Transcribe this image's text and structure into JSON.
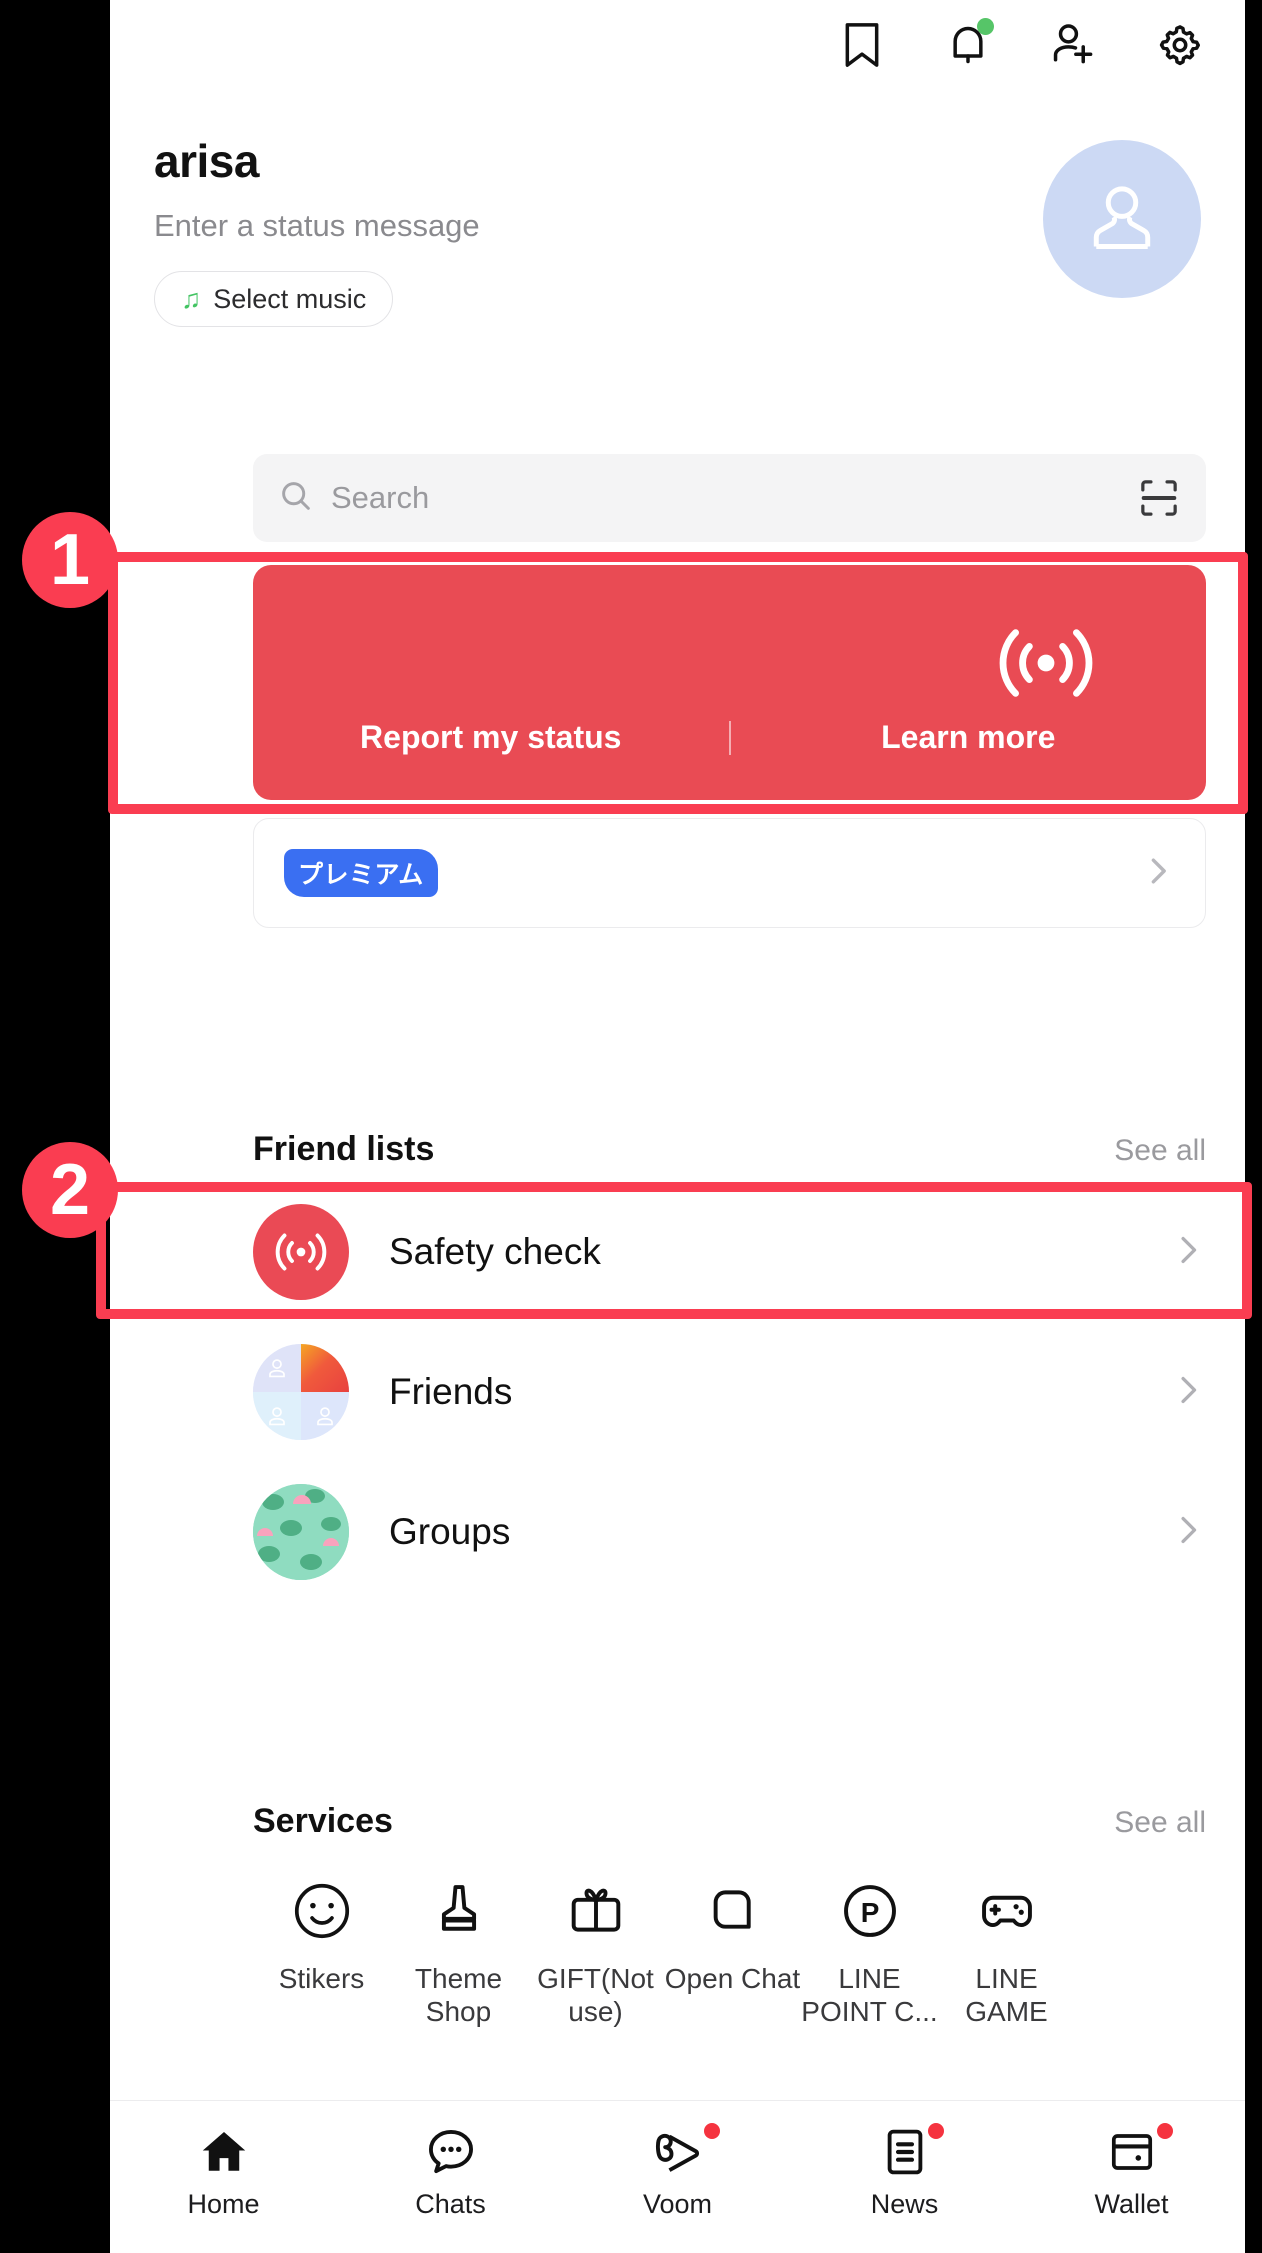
{
  "topbar": {
    "icons": [
      {
        "name": "bookmark-icon",
        "label": "Bookmark"
      },
      {
        "name": "bell-icon",
        "label": "Notifications",
        "badge": true
      },
      {
        "name": "add-friend-icon",
        "label": "Add friends"
      },
      {
        "name": "gear-icon",
        "label": "Settings"
      }
    ]
  },
  "profile": {
    "name": "arisa",
    "status_placeholder": "Enter a status message",
    "music_button": "Select music",
    "music_icon": "music-note-icon",
    "avatar_icon": "person-silhouette-icon",
    "avatar_color": "#ccd9f4"
  },
  "search": {
    "placeholder": "Search",
    "search_icon": "search-icon",
    "qr_icon": "qr-scan-icon"
  },
  "banner": {
    "color": "#e94b54",
    "signal_icon": "broadcast-signal-icon",
    "report_label": "Report my status",
    "learn_label": "Learn more"
  },
  "premium": {
    "badge_text": "プレミアム",
    "badge_color": "#3a6ff2",
    "chevron_icon": "chevron-right-icon"
  },
  "friend_lists": {
    "title": "Friend lists",
    "see_all": "See all",
    "rows": [
      {
        "label": "Safety check",
        "icon": "broadcast-signal-icon"
      },
      {
        "label": "Friends",
        "icon": "friends-quad-avatar"
      },
      {
        "label": "Groups",
        "icon": "groups-avatar"
      }
    ]
  },
  "services": {
    "title": "Services",
    "see_all": "See all",
    "items": [
      {
        "label": "Stikers",
        "icon": "smiley-face-icon"
      },
      {
        "label": "Theme\nShop",
        "icon": "brush-icon"
      },
      {
        "label": "GIFT(Not\nuse)",
        "icon": "gift-icon"
      },
      {
        "label": "Open Chat",
        "icon": "open-chat-icon"
      },
      {
        "label": "LINE\nPOINT C...",
        "icon": "point-p-icon"
      },
      {
        "label": "LINE\nGAME",
        "icon": "gamepad-icon"
      }
    ]
  },
  "bottom_nav": {
    "items": [
      {
        "label": "Home",
        "icon": "home-icon",
        "active": true,
        "badge": false
      },
      {
        "label": "Chats",
        "icon": "chat-bubble-icon",
        "active": false,
        "badge": false
      },
      {
        "label": "Voom",
        "icon": "voom-play-icon",
        "active": false,
        "badge": true
      },
      {
        "label": "News",
        "icon": "news-document-icon",
        "active": false,
        "badge": true
      },
      {
        "label": "Wallet",
        "icon": "wallet-icon",
        "active": false,
        "badge": true
      }
    ]
  },
  "annotations": {
    "color": "#fa3d51",
    "markers": [
      {
        "number": "1",
        "target": "safety-check-banner"
      },
      {
        "number": "2",
        "target": "safety-check-row"
      }
    ]
  }
}
